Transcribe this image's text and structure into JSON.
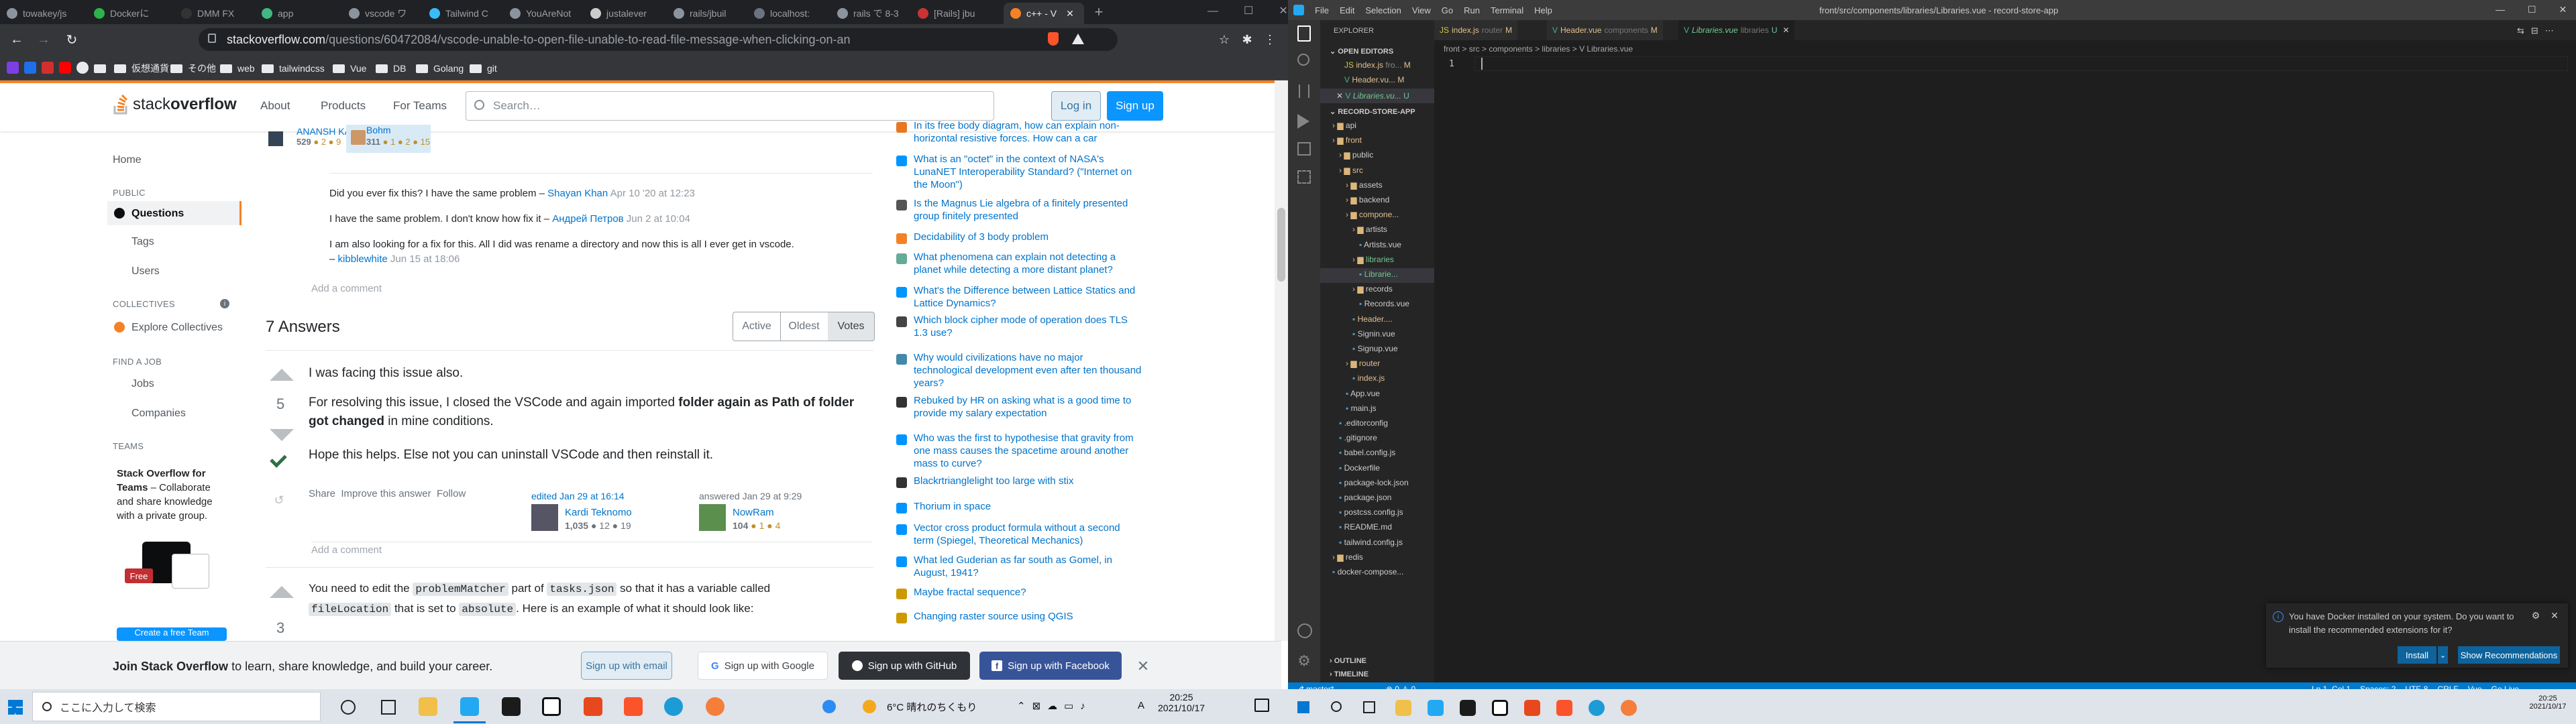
{
  "browser": {
    "tabs": [
      {
        "label": "towakey/js"
      },
      {
        "label": "Dockerに"
      },
      {
        "label": "DMM FX"
      },
      {
        "label": "app"
      },
      {
        "label": "vscode ワ"
      },
      {
        "label": "Tailwind C"
      },
      {
        "label": "YouAreNot"
      },
      {
        "label": "justalever"
      },
      {
        "label": "rails/jbuil"
      },
      {
        "label": "localhost:"
      },
      {
        "label": "rails で 8-3"
      },
      {
        "label": "[Rails] jbu"
      },
      {
        "label": "c++ - V"
      }
    ],
    "url_host": "stackoverflow.com",
    "url_path": "/questions/60472084/vscode-unable-to-open-file-unable-to-read-file-message-when-clicking-on-an",
    "bookmarks": [
      "仮想通貨",
      "その他",
      "web",
      "tailwindcss",
      "Vue",
      "DB",
      "Golang",
      "git"
    ]
  },
  "so": {
    "logo_a": "stack",
    "logo_b": "overflow",
    "nav": [
      "About",
      "Products",
      "For Teams"
    ],
    "search_placeholder": "Search…",
    "login": "Log in",
    "signup": "Sign up",
    "user1": {
      "name": "ANANSH KASHHAK",
      "rep": "529",
      "b": "● 2  ● 9"
    },
    "user2": {
      "name": "Bohm",
      "rep": "311",
      "b": "● 1  ● 2  ● 15"
    },
    "left": {
      "home": "Home",
      "public": "PUBLIC",
      "questions": "Questions",
      "tags": "Tags",
      "users": "Users",
      "collectives": "COLLECTIVES",
      "explore": "Explore Collectives",
      "findjob": "FIND A JOB",
      "jobs": "Jobs",
      "companies": "Companies",
      "teams": "TEAMS",
      "teams_title": "Stack Overflow for",
      "teams_title2": "Teams",
      "teams_desc": " – Collaborate",
      "teams_desc2": "and share knowledge",
      "teams_desc3": "with a private group.",
      "free": "Free",
      "create": "Create a free Team"
    },
    "comments": [
      {
        "text": "Did you ever fix this? I have the same problem – ",
        "user": "Shayan Khan",
        "date": "Apr 10 '20 at 12:23"
      },
      {
        "text": "I have the same problem. I don't know how fix it – ",
        "user": "Андрей Петров",
        "date": "Jun 2 at 10:04"
      },
      {
        "text": "I am also looking for a fix for this. All I did was rename a directory and now this is all I ever get in vscode.",
        "user": "",
        "date": ""
      },
      {
        "text": "– ",
        "user": "kibblewhite",
        "date": "Jun 15 at 18:06"
      }
    ],
    "add_comment": "Add a comment",
    "answers_count": "7 Answers",
    "filters": [
      "Active",
      "Oldest",
      "Votes"
    ],
    "a1": {
      "votes": "5",
      "p1": "I was facing this issue also.",
      "p2a": "For resolving this issue, I closed the VSCode and again imported ",
      "p2b": "folder again as Path of folder",
      "p2c": "got changed",
      "p2d": " in mine conditions.",
      "p3": "Hope this helps. Else not you can uninstall VSCode and then reinstall it.",
      "share": "Share",
      "improve": "Improve this answer",
      "follow": "Follow",
      "edited": "edited Jan 29 at 16:14",
      "editor": "Kardi Teknomo",
      "editor_rep": "1,035",
      "editor_b": "● 12  ● 19",
      "answered": "answered Jan 29 at 9:29",
      "author": "NowRam",
      "author_rep": "104",
      "author_b": "● 1  ● 4"
    },
    "a2": {
      "votes": "3",
      "t1": "You need to edit the ",
      "c1": "problemMatcher",
      "t2": " part of ",
      "c2": "tasks.json",
      "t3": " so that it has a variable called",
      "c3": "fileLocation",
      "t4": " that is set to ",
      "c4": "absolute",
      "t5": ". Here is an example of what it should look like:"
    },
    "hot": [
      "In its free body diagram, how can explain non-horizontal resistive forces. How can a car accelerate forward?",
      "What is an \"octet\" in the context of NASA's LunaNET Interoperability Standard? (\"Internet on the Moon\")",
      "Is the Magnus Lie algebra of a finitely presented group finitely presented",
      "Decidability of 3 body problem",
      "What phenomena can explain not detecting a planet while detecting a more distant planet?",
      "What's the Difference between Lattice Statics and Lattice Dynamics?",
      "Which block cipher mode of operation does TLS 1.3 use?",
      "Why would civilizations have no major technological development even after ten thousand years?",
      "Rebuked by HR on asking what is a good time to provide my salary expectation",
      "Who was the first to hypothesise that gravity from one mass causes the spacetime around another mass to curve?",
      "Blackrtrianglelight too large with stix",
      "Thorium in space",
      "Vector cross product formula without a second term (Spiegel, Theoretical Mechanics)",
      "What led Guderian as far south as Gomel, in August, 1941?",
      "Maybe fractal sequence?",
      "Changing raster source using QGIS"
    ],
    "join": {
      "text_b": "Join Stack Overflow",
      "text": " to learn, share knowledge, and build your career.",
      "email": "Sign up with email",
      "google": "Sign up with Google",
      "github": "Sign up with GitHub",
      "facebook": "Sign up with Facebook"
    }
  },
  "vscode": {
    "menu": [
      "File",
      "Edit",
      "Selection",
      "View",
      "Go",
      "Run",
      "Terminal",
      "Help"
    ],
    "title": "front/src/components/libraries/Libraries.vue - record-store-app",
    "explorer": "EXPLORER",
    "open_editors": "OPEN EDITORS",
    "open_files": [
      {
        "name": "index.js",
        "path": "fro...",
        "m": "M"
      },
      {
        "name": "Header.vu...",
        "path": "",
        "m": "M"
      },
      {
        "name": "Libraries.vu...",
        "path": "",
        "m": "U"
      }
    ],
    "tabs": [
      {
        "name": "index.js",
        "path": "router",
        "m": "M"
      },
      {
        "name": "Header.vue",
        "path": "components",
        "m": "M"
      },
      {
        "name": "Libraries.vue",
        "path": "libraries",
        "m": "U"
      }
    ],
    "breadcrumb": "front > src > components > libraries > V Libraries.vue",
    "project": "RECORD-STORE-APP",
    "tree": [
      "api",
      "front",
      "public",
      "src",
      "assets",
      "backend",
      "compone...",
      "artists",
      "Artists.vue",
      "libraries",
      "Librarie...",
      "records",
      "Records.vue",
      "Header....",
      "Signin.vue",
      "Signup.vue",
      "router",
      "index.js",
      "App.vue",
      "main.js",
      ".editorconfig",
      ".gitignore",
      "babel.config.js",
      "Dockerfile",
      "package-lock.json",
      "package.json",
      "postcss.config.js",
      "README.md",
      "tailwind.config.js",
      "redis",
      "docker-compose..."
    ],
    "outline": "OUTLINE",
    "timeline": "TIMELINE",
    "line_no": "1",
    "notif_text": "You have Docker installed on your system. Do you want to install the recommended extensions for it?",
    "install": "Install",
    "show_rec": "Show Recommendations",
    "status_left": "master*",
    "status_counts": "⊗ 0  ⚠ 0",
    "status_right": [
      "Ln 1, Col 1",
      "Spaces: 2",
      "UTF-8",
      "CRLF",
      "Vue",
      "Go Live"
    ]
  },
  "taskbar": {
    "search": "ここに入力して検索",
    "weather": "6°C  晴れのちくもり",
    "time": "20:25",
    "date": "2021/10/17",
    "lang": "A"
  }
}
